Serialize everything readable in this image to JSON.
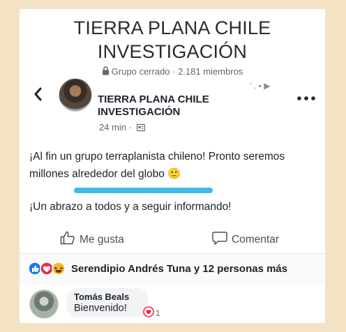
{
  "group": {
    "title_line1": "TIERRA PLANA CHILE",
    "title_line2": "INVESTIGACIÓN",
    "meta": "Grupo cerrado · 2.181 miembros"
  },
  "post": {
    "author_line1": "TIERRA PLANA CHILE",
    "author_line2": "INVESTIGACIÓN",
    "time": "24 min ·",
    "faint_header": "‘             .     ▪ ▶",
    "paragraph1_line1": "¡Al fin un grupo terraplanista chileno! Pronto seremos",
    "paragraph1_line2": "millones alrededor del globo",
    "emoji": "🙂",
    "paragraph2": "¡Un abrazo a todos y a seguir informando!"
  },
  "actions": {
    "like_label": "Me gusta",
    "comment_label": "Comentar"
  },
  "reactions": {
    "summary": "Serendipio Andrés Tuna y 12 personas más"
  },
  "comment": {
    "author": "Tomás Beals",
    "text": "Bienvenido!",
    "likes": "1"
  },
  "colors": {
    "background": "#f3e3c4",
    "highlight": "#3dbde6",
    "like_blue": "#1877f2",
    "love_red": "#f02849",
    "haha_yellow": "#f7b928"
  },
  "icons": [
    "lock-icon",
    "back-icon",
    "more-icon",
    "audience-icon",
    "thumbs-up-icon",
    "comment-icon",
    "like-reaction-icon",
    "love-reaction-icon",
    "haha-reaction-icon",
    "heart-icon"
  ]
}
